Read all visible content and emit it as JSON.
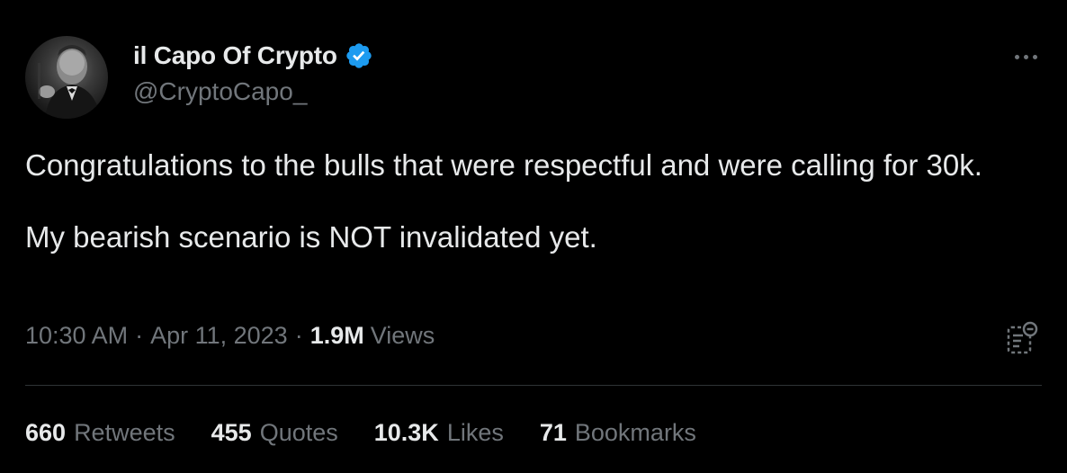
{
  "author": {
    "display_name": "il Capo Of Crypto",
    "handle": "@CryptoCapo_",
    "verified_icon": "verified-badge-icon",
    "verified_color": "#1d9bf0"
  },
  "tweet": {
    "paragraphs": [
      "Congratulations to the bulls that were respectful and were calling for 30k.",
      "My bearish scenario is NOT invalidated yet."
    ]
  },
  "meta": {
    "time": "10:30 AM",
    "separator": "·",
    "date": "Apr 11, 2023",
    "views_count": "1.9M",
    "views_label": "Views"
  },
  "stats": {
    "retweets": {
      "count": "660",
      "label": "Retweets"
    },
    "quotes": {
      "count": "455",
      "label": "Quotes"
    },
    "likes": {
      "count": "10.3K",
      "label": "Likes"
    },
    "bookmarks": {
      "count": "71",
      "label": "Bookmarks"
    }
  },
  "colors": {
    "background": "#000000",
    "primary_text": "#e7e9ea",
    "secondary_text": "#71767b",
    "divider": "#2f3336"
  }
}
